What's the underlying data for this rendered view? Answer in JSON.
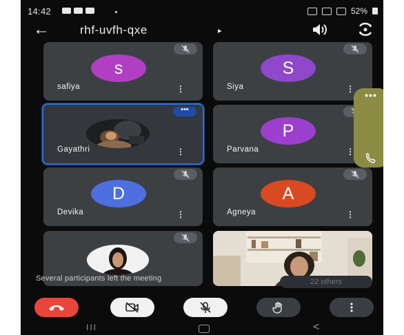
{
  "status_bar": {
    "time": "14:42",
    "battery": "52%"
  },
  "meeting": {
    "code": "rhf-uvfh-qxe",
    "caret": "▸"
  },
  "participants": [
    {
      "name": "safiya",
      "initial": "s",
      "color": "#b03fc4"
    },
    {
      "name": "Siya",
      "initial": "S",
      "color": "#8e48c9"
    },
    {
      "name": "Gayathri",
      "initial": "",
      "color": "#1b1d1f"
    },
    {
      "name": "Parvana",
      "initial": "P",
      "color": "#9c3fcf"
    },
    {
      "name": "Devika",
      "initial": "D",
      "color": "#4e6fe0"
    },
    {
      "name": "Agneya",
      "initial": "A",
      "color": "#d84a22"
    }
  ],
  "pip": {
    "dots": "•••"
  },
  "toast": {
    "message": "Several participants left the meeting",
    "others_label": "22 others"
  },
  "tile_more_label": "⋮",
  "tile_options_label": "•••",
  "navbar": {
    "recents": "III",
    "back": "<"
  },
  "controls": {
    "end_call": "end-call",
    "camera": "camera-off",
    "mic": "mic-off",
    "raise_hand": "raise-hand",
    "more": "⋮"
  }
}
